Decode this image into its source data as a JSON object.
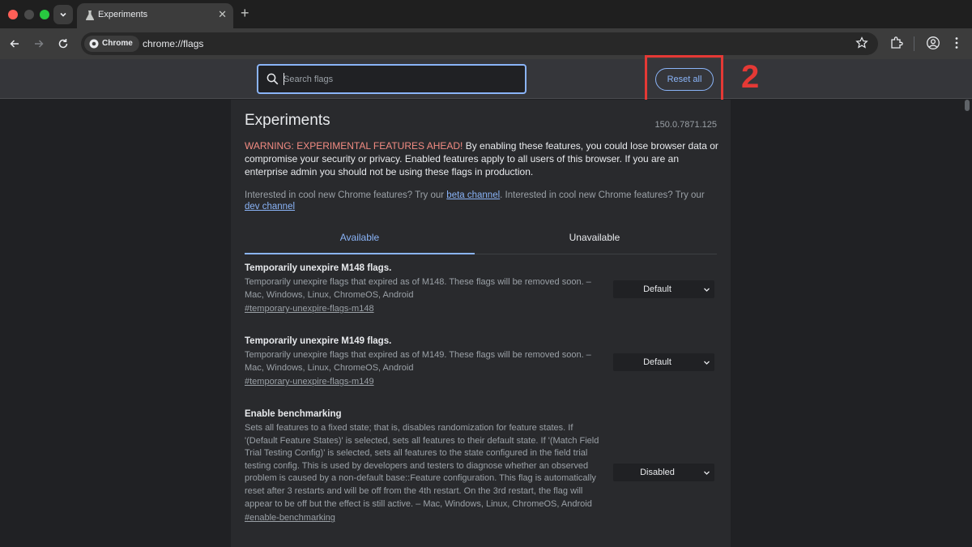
{
  "window": {
    "tab_title": "Experiments",
    "url_chip": "Chrome",
    "url": "chrome://flags"
  },
  "flags_header": {
    "search_placeholder": "Search flags",
    "reset_label": "Reset all",
    "annotation_number": "2"
  },
  "main": {
    "title": "Experiments",
    "version": "150.0.7871.125",
    "warning_prefix": "WARNING: EXPERIMENTAL FEATURES AHEAD!",
    "warning_body": " By enabling these features, you could lose browser data or compromise your security or privacy. Enabled features apply to all users of this browser. If you are an enterprise admin you should not be using these flags in production.",
    "interested_1": "Interested in cool new Chrome features? Try our ",
    "beta_link": "beta channel",
    "interested_2": ". Interested in cool new Chrome features? Try our ",
    "dev_link": "dev channel",
    "tabs": [
      {
        "label": "Available",
        "active": true
      },
      {
        "label": "Unavailable",
        "active": false
      }
    ]
  },
  "flags": [
    {
      "name": "Temporarily unexpire M148 flags.",
      "description": "Temporarily unexpire flags that expired as of M148. These flags will be removed soon. – Mac, Windows, Linux, ChromeOS, Android",
      "link": "#temporary-unexpire-flags-m148",
      "value": "Default"
    },
    {
      "name": "Temporarily unexpire M149 flags.",
      "description": "Temporarily unexpire flags that expired as of M149. These flags will be removed soon. – Mac, Windows, Linux, ChromeOS, Android",
      "link": "#temporary-unexpire-flags-m149",
      "value": "Default"
    },
    {
      "name": "Enable benchmarking",
      "description": "Sets all features to a fixed state; that is, disables randomization for feature states. If '(Default Feature States)' is selected, sets all features to their default state. If '(Match Field Trial Testing Config)' is selected, sets all features to the state configured in the field trial testing config. This is used by developers and testers to diagnose whether an observed problem is caused by a non-default base::Feature configuration. This flag is automatically reset after 3 restarts and will be off from the 4th restart. On the 3rd restart, the flag will appear to be off but the effect is still active. – Mac, Windows, Linux, ChromeOS, Android",
      "link": "#enable-benchmarking",
      "value": "Disabled"
    }
  ],
  "colors": {
    "accent": "#8ab4f8",
    "warning": "#f28b82",
    "annotation": "#e53935"
  }
}
